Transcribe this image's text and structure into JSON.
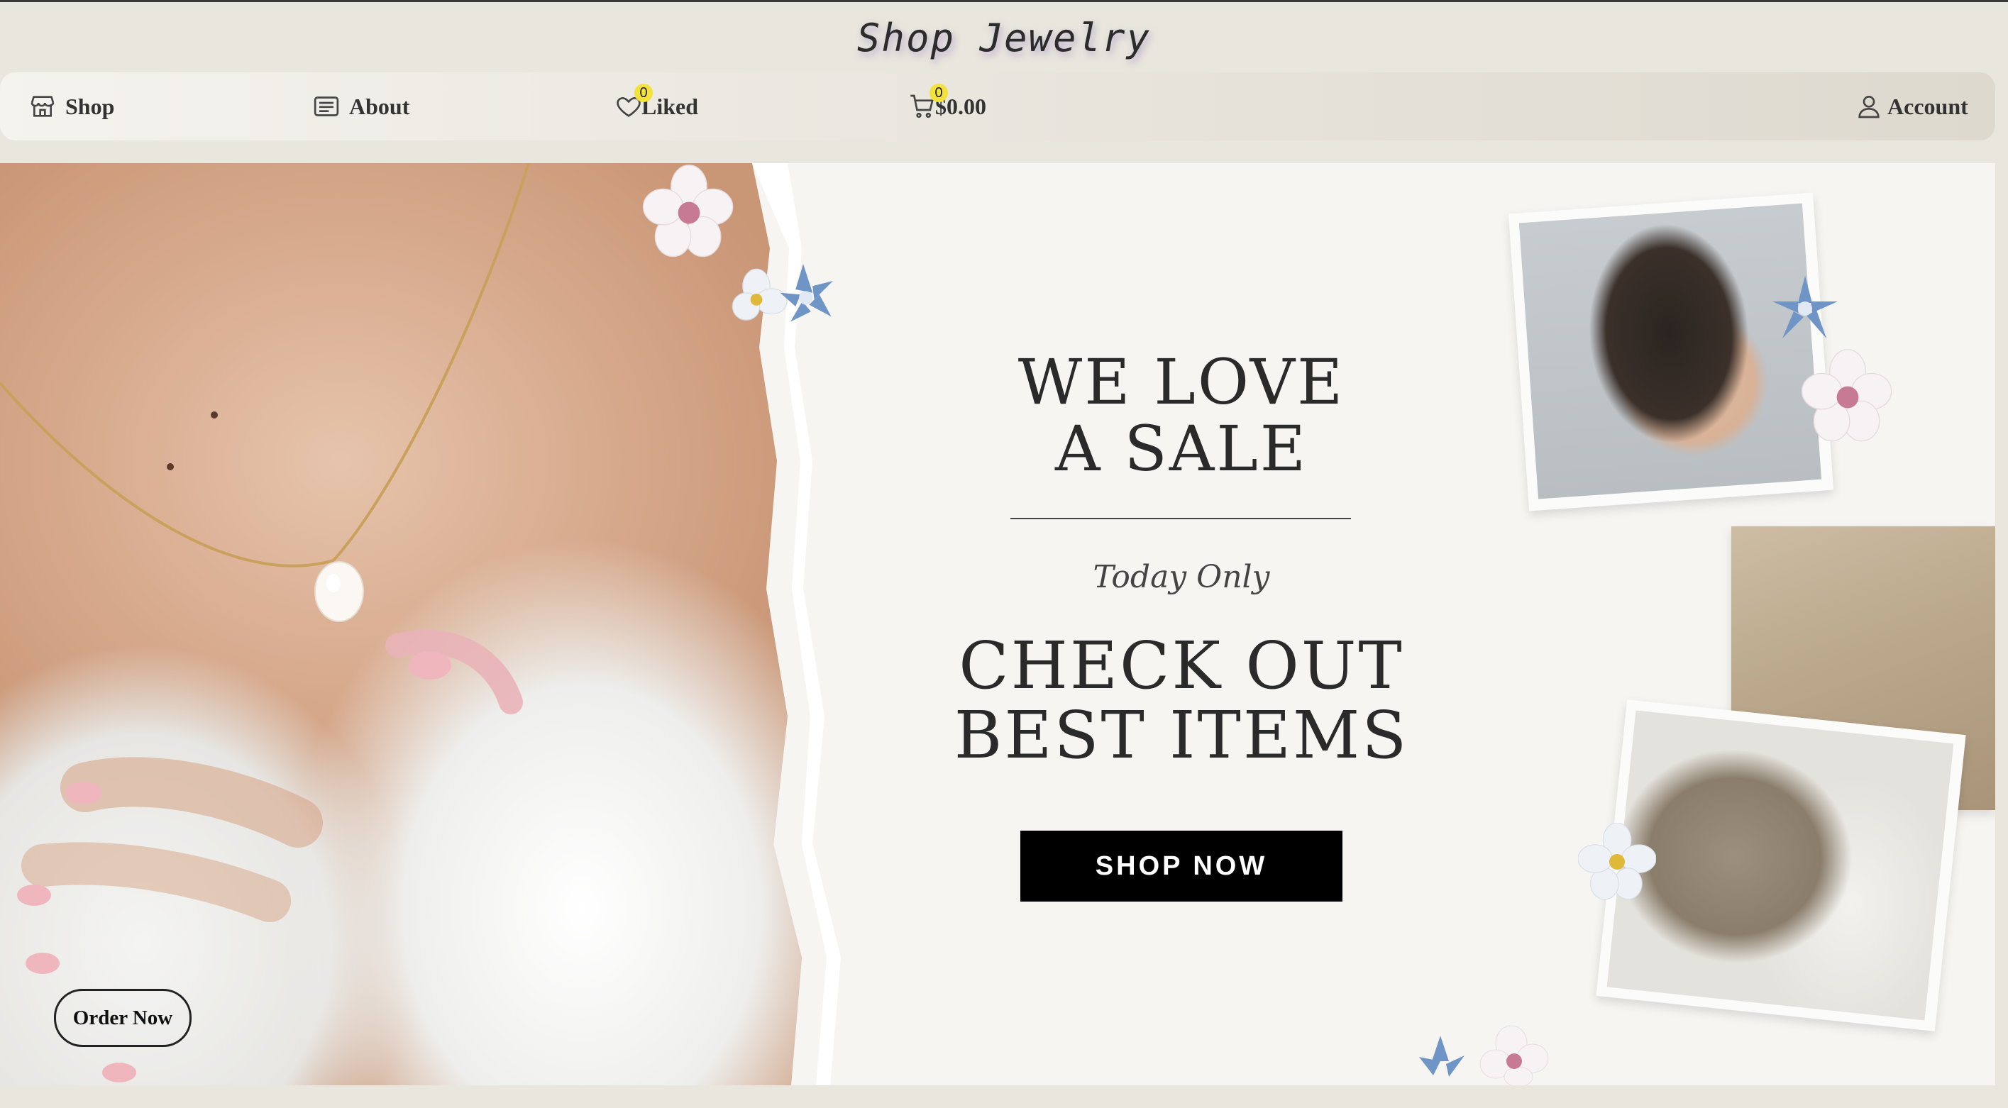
{
  "site": {
    "title": "Shop Jewelry"
  },
  "nav": {
    "shop": "Shop",
    "about": "About",
    "liked": "Liked",
    "liked_count": "0",
    "cart_total": "$0.00",
    "cart_count": "0",
    "account": "Account"
  },
  "hero": {
    "headline": "WE LOVE\nA SALE",
    "subhead": "Today Only",
    "headline2": "CHECK OUT\nBEST ITEMS",
    "cta": "SHOP NOW",
    "order_button": "Order Now"
  },
  "colors": {
    "badge": "#f2e23a",
    "cta_background": "#000000"
  },
  "icons": [
    "store-icon",
    "newspaper-icon",
    "heart-icon",
    "cart-icon",
    "user-icon"
  ]
}
